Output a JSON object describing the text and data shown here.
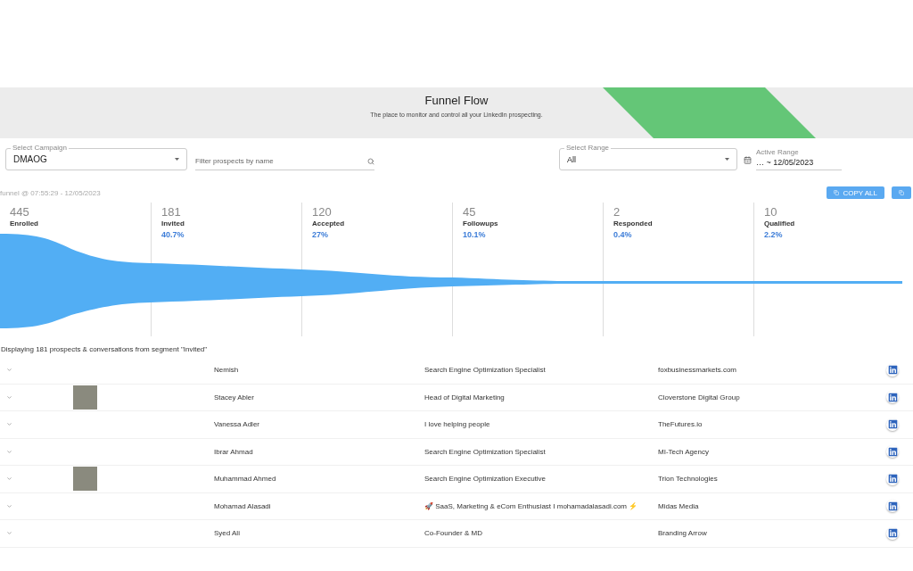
{
  "header": {
    "title": "Funnel Flow",
    "subtitle": "The place to monitor and control all your LinkedIn prospecting."
  },
  "filters": {
    "campaign": {
      "label": "Select Campaign",
      "value": "DMAOG"
    },
    "search": {
      "placeholder": "Filter prospects by name"
    },
    "range": {
      "label": "Select Range",
      "value": "All"
    },
    "active_range": {
      "label": "Active Range",
      "value": "… ~ 12/05/2023"
    }
  },
  "timestamp": "funnel @ 07:55:29 - 12/05/2023",
  "copy_all": "COPY ALL",
  "stages": [
    {
      "count": "445",
      "label": "Enrolled"
    },
    {
      "count": "181",
      "label": "Invited",
      "percent": "40.7%"
    },
    {
      "count": "120",
      "label": "Accepted",
      "percent": "27%"
    },
    {
      "count": "45",
      "label": "Followups",
      "percent": "10.1%"
    },
    {
      "count": "2",
      "label": "Responded",
      "percent": "0.4%"
    },
    {
      "count": "10",
      "label": "Qualified",
      "percent": "2.2%"
    }
  ],
  "caption": "Displaying 181 prospects & conversations from segment \"Invited\"",
  "prospects": [
    {
      "name": "Nemish",
      "headline": "Search Engine Optimization Specialist",
      "company": "foxbusinessmarkets.com",
      "has_photo": false
    },
    {
      "name": "Stacey Abler",
      "headline": "Head of Digital Marketing",
      "company": "Cloverstone Digital Group",
      "has_photo": true
    },
    {
      "name": "Vanessa Adler",
      "headline": "I love helping people",
      "company": "TheFutures.io",
      "has_photo": false
    },
    {
      "name": "Ibrar Ahmad",
      "headline": "Search Engine Optimization Specialist",
      "company": "MI-Tech Agency",
      "has_photo": false
    },
    {
      "name": "Muhammad Ahmed",
      "headline": "Search Engine Optimization Executive",
      "company": "Trion Technologies",
      "has_photo": true
    },
    {
      "name": "Mohamad Alasadi",
      "headline": "🚀 SaaS, Marketing & eCom Enthusiast I mohamadalasadi.com ⚡",
      "company": "Midas Media",
      "has_photo": false
    },
    {
      "name": "Syed Ali",
      "headline": "Co-Founder & MD",
      "company": "Branding Arrow",
      "has_photo": false
    }
  ]
}
